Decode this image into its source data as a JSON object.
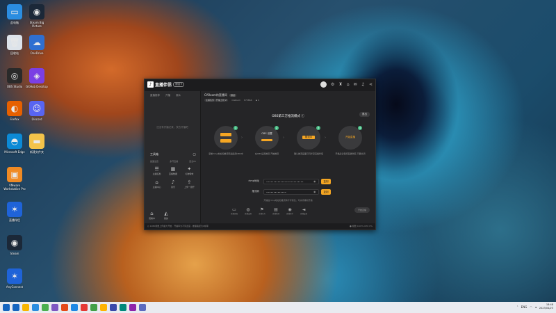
{
  "desktop": {
    "icons": [
      {
        "label": "此电脑",
        "color": "#2b8de0",
        "glyph": "▭",
        "icon": "computer-icon"
      },
      {
        "label": "Steam Big Picture",
        "color": "#1b2838",
        "glyph": "◉",
        "icon": "steam-icon"
      },
      {
        "label": "回收站",
        "color": "#dde3ea",
        "glyph": "🗑",
        "icon": "recycle-bin-icon"
      },
      {
        "label": "OneDrive",
        "color": "#2f6fd1",
        "glyph": "☁",
        "icon": "cloud-icon"
      },
      {
        "label": "OBS Studio",
        "color": "#2a2a2a",
        "glyph": "◎",
        "icon": "obs-icon"
      },
      {
        "label": "GitHub Desktop",
        "color": "#7b3fe4",
        "glyph": "◈",
        "icon": "github-icon"
      },
      {
        "label": "Firefox",
        "color": "#e66000",
        "glyph": "◐",
        "icon": "firefox-icon"
      },
      {
        "label": "Discord",
        "color": "#5865f2",
        "glyph": "☺",
        "icon": "discord-icon"
      },
      {
        "label": "Microsoft Edge",
        "color": "#0c8ad6",
        "glyph": "◓",
        "icon": "edge-icon"
      },
      {
        "label": "新建文件夹",
        "color": "#f3c34a",
        "glyph": "▬",
        "icon": "folder-icon"
      },
      {
        "label": "VMware Workstation Pro",
        "color": "#f08a24",
        "glyph": "▣",
        "icon": "vmware-icon"
      },
      {
        "label": "直播伴侣",
        "color": "#1f63d8",
        "glyph": "✶",
        "icon": "network-icon"
      },
      {
        "label": "Steam",
        "color": "#1b2838",
        "glyph": "◉",
        "icon": "steam-icon"
      },
      {
        "label": "AnyConnect",
        "color": "#1f63d8",
        "glyph": "✶",
        "icon": "network-icon"
      }
    ]
  },
  "app": {
    "logo_text": "直播伴侣",
    "logo_badge": "测试 ▾",
    "left": {
      "tabs": [
        "直播推荐",
        "开播",
        "观众"
      ],
      "empty_text": "还没有开播记录，快去开播吧",
      "tools_title": "工具箱",
      "tools_sub": [
        "画面设置",
        "多开直播",
        "连麦PK"
      ],
      "tools": [
        {
          "label": "主播任务",
          "icon": "task-icon",
          "glyph": "☰"
        },
        {
          "label": "直播数据",
          "icon": "data-icon",
          "glyph": "▦"
        },
        {
          "label": "礼物特效",
          "icon": "gift-icon",
          "glyph": "✦"
        },
        {
          "label": "主播中心",
          "icon": "home-icon",
          "glyph": "⌂"
        },
        {
          "label": "音乐",
          "icon": "music-icon",
          "glyph": "♪"
        },
        {
          "label": "上传一键开",
          "icon": "share-icon",
          "glyph": "⇪"
        }
      ],
      "bottom": [
        {
          "label": "观看中",
          "icon": "house-icon",
          "glyph": "⌂"
        },
        {
          "label": "我的",
          "icon": "user-icon",
          "glyph": "◭"
        }
      ]
    },
    "main": {
      "room_title": "CARoom的直播间",
      "room_tag": "测试",
      "room_chip": "主播任务 · 开播上线 ⇄",
      "room_id": "CARoom",
      "room_num": "873866",
      "room_fans": "♟ 0",
      "mode_title": "OBS第三方推流模式 ⓘ",
      "exit_label": "退出",
      "steps": [
        {
          "num": "1",
          "inner": "",
          "desc": "复制rtmp地址和推流码粘贴到OBS中"
        },
        {
          "num": "2",
          "inner": "OBS 设置",
          "desc": "在OBS设置推流 开始推流"
        },
        {
          "num": "3",
          "inner": "推流中",
          "desc": "确认推流画面已同步至直播伴侣"
        },
        {
          "num": "4",
          "inner": "开始直播",
          "desc": "开播后请保持直播伴侣 不要关闭"
        }
      ],
      "rtmp_label": "rtmp地址",
      "rtmp_value": "••••••••••••••••••••••••••",
      "key_label": "推流码",
      "key_value": "••••••••••••••",
      "copy_label": "复制",
      "hint": "开播后rtmp地址和推流码不可修改，可关闭重新开播",
      "bottom_items": [
        {
          "label": "直播画面",
          "icon": "screen-icon",
          "glyph": "▭"
        },
        {
          "label": "直播设置",
          "icon": "settings-icon",
          "glyph": "◍"
        },
        {
          "label": "主播任务",
          "icon": "flag-icon",
          "glyph": "⚑"
        },
        {
          "label": "直播管理",
          "icon": "manage-icon",
          "glyph": "▤"
        },
        {
          "label": "直播助手",
          "icon": "helper-icon",
          "glyph": "◉"
        },
        {
          "label": "直播设备",
          "icon": "camera-icon",
          "glyph": "◄"
        }
      ],
      "live_label": "开始直播"
    },
    "status": {
      "left": "◎ 1080帧数上传超大开始 · 开播率为不同宽度 · 推理路径为0帧率",
      "right": "● 帧数 0.00%   CPU 0%"
    }
  },
  "taskbar": {
    "items": [
      "#1565c0",
      "#f7b500",
      "#2b8de0",
      "#4caf50",
      "#7e57c2",
      "#e64a19",
      "#1e88e5",
      "#e53935",
      "#43a047",
      "#ffb300",
      "#3949ab",
      "#00897b",
      "#8e24aa",
      "#5c6bc0"
    ],
    "time": "18:48",
    "date": "2023/04/23",
    "lang": "ENG"
  }
}
